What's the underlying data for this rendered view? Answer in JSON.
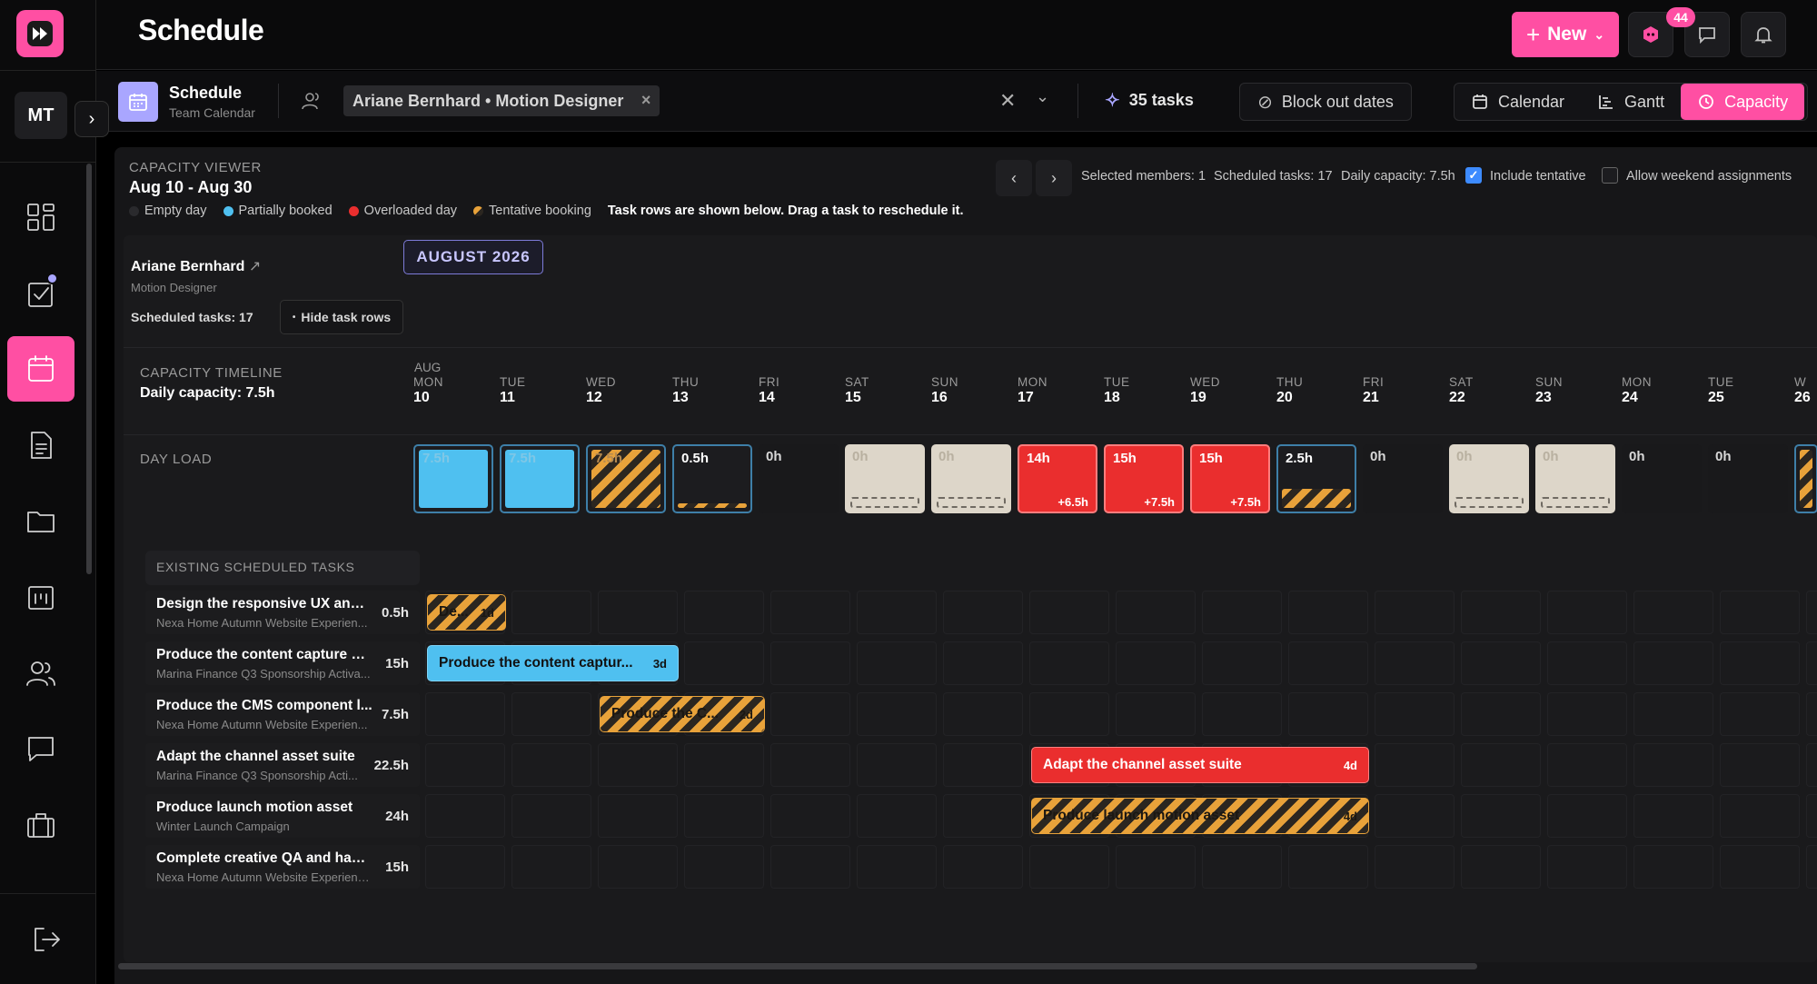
{
  "app": {
    "title": "Schedule"
  },
  "sidebar": {
    "avatar": "MT",
    "icons": [
      "dashboard-icon",
      "tasks-icon",
      "calendar-icon",
      "document-icon",
      "folder-icon",
      "projects-icon",
      "people-icon",
      "chat-icon",
      "briefcase-icon"
    ],
    "active": "calendar-icon",
    "logout_icon": "logout-icon"
  },
  "topbar": {
    "new_label": "New",
    "notifications": "44"
  },
  "subbar": {
    "title": "Schedule",
    "subtitle": "Team Calendar",
    "filter_chip": "Ariane Bernhard • Motion Designer",
    "tasks_count": "35 tasks",
    "block_out": "Block out dates",
    "views": [
      {
        "label": "Calendar"
      },
      {
        "label": "Gantt"
      },
      {
        "label": "Capacity"
      }
    ],
    "active_view": "Capacity"
  },
  "viewer": {
    "label": "CAPACITY VIEWER",
    "range": "Aug 10 - Aug 30",
    "selected_members": "Selected members: 1",
    "scheduled_tasks": "Scheduled tasks: 17",
    "daily_capacity": "Daily capacity: 7.5h",
    "include_tentative": "Include tentative",
    "include_tentative_checked": true,
    "allow_weekend": "Allow weekend assignments",
    "allow_weekend_checked": false,
    "legend": [
      {
        "label": "Empty day",
        "color": "#2a2a2d"
      },
      {
        "label": "Partially booked",
        "color": "#4fc0f0"
      },
      {
        "label": "Overloaded day",
        "color": "#ea2e2e"
      },
      {
        "label": "Tentative booking",
        "color": "#e8a23a"
      }
    ],
    "hint": "Task rows are shown below. Drag a task to reschedule it."
  },
  "person": {
    "name": "Ariane Bernhard",
    "role": "Motion Designer",
    "scheduled": "Scheduled tasks: 17",
    "hide_rows": "Hide task rows",
    "month": "AUGUST 2026"
  },
  "timeline": {
    "label": "CAPACITY TIMELINE",
    "daily_capacity": "Daily capacity: 7.5h",
    "day_load_label": "DAY LOAD",
    "month_abbr": "AUG",
    "days": [
      {
        "wd": "MON",
        "d": "10",
        "load": "7.5h",
        "state": "partial",
        "fill": 1.0
      },
      {
        "wd": "TUE",
        "d": "11",
        "load": "7.5h",
        "state": "partial",
        "fill": 1.0
      },
      {
        "wd": "WED",
        "d": "12",
        "load": "7.5h",
        "state": "tentative",
        "fill": 1.0
      },
      {
        "wd": "THU",
        "d": "13",
        "load": "0.5h",
        "state": "tentative-low",
        "fill": 0.07
      },
      {
        "wd": "FRI",
        "d": "14",
        "load": "0h",
        "state": "empty"
      },
      {
        "wd": "SAT",
        "d": "15",
        "load": "0h",
        "state": "weekend"
      },
      {
        "wd": "SUN",
        "d": "16",
        "load": "0h",
        "state": "weekend"
      },
      {
        "wd": "MON",
        "d": "17",
        "load": "14h",
        "state": "over",
        "over": "+6.5h"
      },
      {
        "wd": "TUE",
        "d": "18",
        "load": "15h",
        "state": "over",
        "over": "+7.5h"
      },
      {
        "wd": "WED",
        "d": "19",
        "load": "15h",
        "state": "over",
        "over": "+7.5h"
      },
      {
        "wd": "THU",
        "d": "20",
        "load": "2.5h",
        "state": "tentative-low",
        "fill": 0.33
      },
      {
        "wd": "FRI",
        "d": "21",
        "load": "0h",
        "state": "empty"
      },
      {
        "wd": "SAT",
        "d": "22",
        "load": "0h",
        "state": "weekend"
      },
      {
        "wd": "SUN",
        "d": "23",
        "load": "0h",
        "state": "weekend"
      },
      {
        "wd": "MON",
        "d": "24",
        "load": "0h",
        "state": "empty"
      },
      {
        "wd": "TUE",
        "d": "25",
        "load": "0h",
        "state": "empty"
      },
      {
        "wd": "W",
        "d": "26",
        "load": "",
        "state": "tentative"
      }
    ]
  },
  "tasks": {
    "label": "EXISTING SCHEDULED TASKS",
    "rows": [
      {
        "name": "Design the responsive UX and ...",
        "project": "Nexa Home Autumn Website Experien...",
        "hours": "0.5h",
        "bar_label": "De...",
        "bar_days": "1d",
        "bar_style": "tentative",
        "start": 0,
        "span": 1
      },
      {
        "name": "Produce the content capture pl...",
        "project": "Marina Finance Q3 Sponsorship Activa...",
        "hours": "15h",
        "bar_label": "Produce the content captur...",
        "bar_days": "3d",
        "bar_style": "blue",
        "start": 0,
        "span": 3
      },
      {
        "name": "Produce the CMS component l...",
        "project": "Nexa Home Autumn Website Experien...",
        "hours": "7.5h",
        "bar_label": "Produce the C...",
        "bar_days": "2d",
        "bar_style": "tentative",
        "start": 2,
        "span": 2
      },
      {
        "name": "Adapt the channel asset suite",
        "project": "Marina Finance Q3 Sponsorship Acti...",
        "hours": "22.5h",
        "bar_label": "Adapt the channel asset suite",
        "bar_days": "4d",
        "bar_style": "red",
        "start": 7,
        "span": 4
      },
      {
        "name": "Produce launch motion asset",
        "project": "Winter Launch Campaign",
        "hours": "24h",
        "bar_label": "Produce launch motion asset",
        "bar_days": "4d",
        "bar_style": "tentative",
        "start": 7,
        "span": 4
      },
      {
        "name": "Complete creative QA and hand...",
        "project": "Nexa Home Autumn Website Experienc...",
        "hours": "15h",
        "bar_label": "",
        "bar_days": "",
        "bar_style": "none",
        "start": 0,
        "span": 0
      }
    ]
  }
}
